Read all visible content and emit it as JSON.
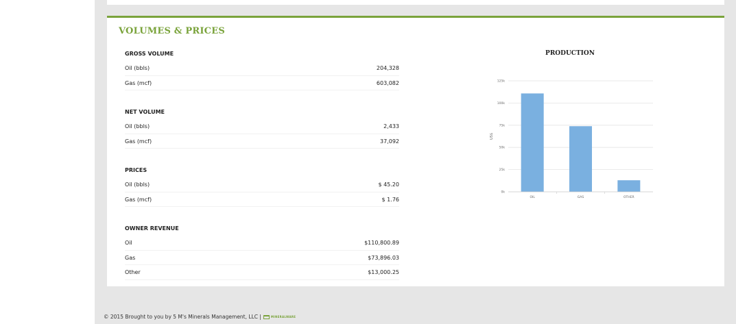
{
  "section": {
    "title": "VOLUMES & PRICES"
  },
  "groups": [
    {
      "header": "GROSS VOLUME",
      "rows": [
        {
          "label": "Oil (bbls)",
          "value": "204,328"
        },
        {
          "label": "Gas (mcf)",
          "value": "603,082"
        }
      ]
    },
    {
      "header": "NET VOLUME",
      "rows": [
        {
          "label": "Oil (bbls)",
          "value": "2,433"
        },
        {
          "label": "Gas (mcf)",
          "value": "37,092"
        }
      ]
    },
    {
      "header": "PRICES",
      "rows": [
        {
          "label": "Oil (bbls)",
          "value": "$ 45.20"
        },
        {
          "label": "Gas (mcf)",
          "value": "$ 1.76"
        }
      ]
    },
    {
      "header": "OWNER REVENUE",
      "rows": [
        {
          "label": "Oil",
          "value": "$110,800.89"
        },
        {
          "label": "Gas",
          "value": "$73,896.03"
        },
        {
          "label": "Other",
          "value": "$13,000.25"
        }
      ]
    }
  ],
  "chart_data": {
    "type": "bar",
    "title": "PRODUCTION",
    "ylabel": "US$",
    "xlabel": "",
    "categories": [
      "OIL",
      "GAS",
      "OTHER"
    ],
    "values": [
      110800.89,
      73896.03,
      13000.25
    ],
    "ylim": [
      0,
      125000
    ],
    "yticks": [
      0,
      25000,
      50000,
      75000,
      100000,
      125000
    ],
    "ytick_labels": [
      "0k",
      "25k",
      "50k",
      "75k",
      "100k",
      "125k"
    ],
    "grid": true,
    "bar_color": "#7ab0e0"
  },
  "footer": {
    "text": "© 2015 Brought to you by 5 M's Minerals Management, LLC |",
    "logo_text": "MINERALWARE"
  }
}
